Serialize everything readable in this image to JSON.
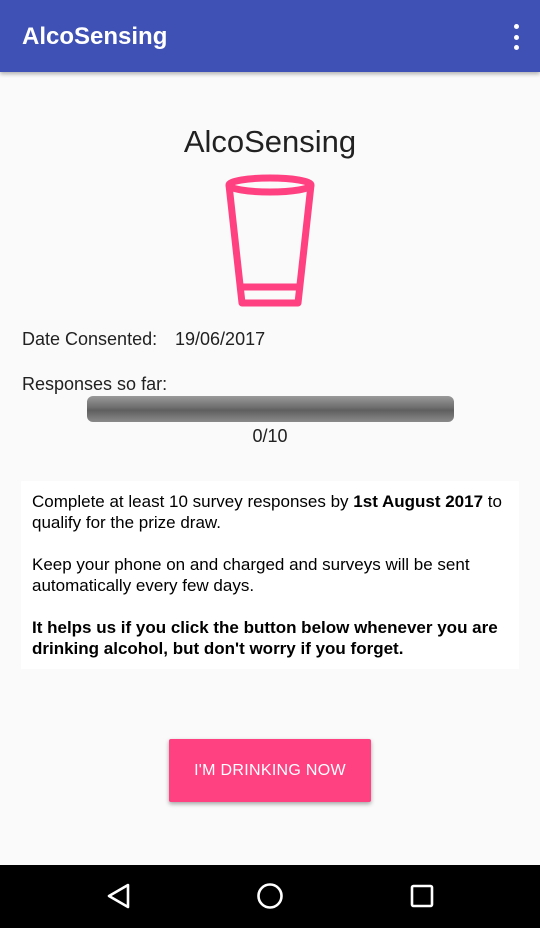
{
  "app_bar": {
    "title": "AlcoSensing",
    "menu_icon": "more-vert-icon",
    "color": "#3f51b5"
  },
  "main": {
    "heading": "AlcoSensing",
    "glass_icon": "glass-icon",
    "accent_color": "#ff4081",
    "date_consented_label": "Date Consented:",
    "date_consented_value": "19/06/2017",
    "responses_label": "Responses so far:",
    "responses_progress": 0.0,
    "responses_count": "0/10"
  },
  "info": {
    "p1_prefix": "Complete at least 10 survey responses by ",
    "p1_bold": "1st August 2017",
    "p1_suffix": " to qualify for the prize draw.",
    "p2": "Keep your phone on and charged and surveys will be sent automatically every few days.",
    "p3": "It helps us if you click the button below whenever you are drinking alcohol, but don't worry if you forget."
  },
  "action_button": {
    "label": "I'M DRINKING NOW"
  },
  "nav_bar": {
    "back_icon": "back-icon",
    "home_icon": "home-icon",
    "recents_icon": "recents-icon"
  }
}
